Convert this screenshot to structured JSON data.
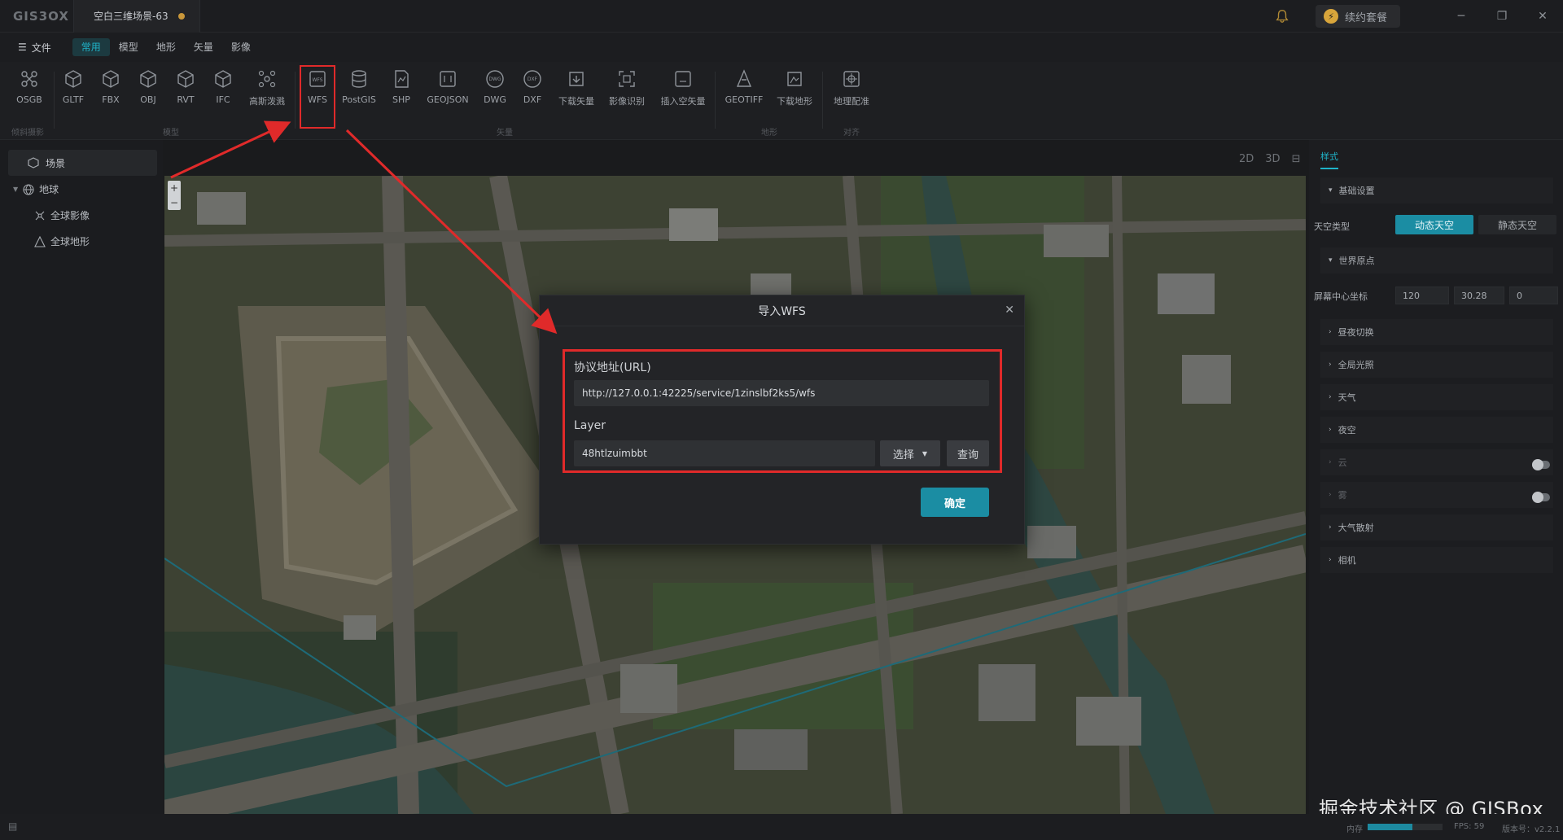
{
  "titlebar": {
    "logo": "GIS3OX",
    "doc_title": "空白三维场景-63",
    "renew_label": "续约套餐"
  },
  "menubar": {
    "file_label": "文件",
    "items": [
      "常用",
      "模型",
      "地形",
      "矢量",
      "影像"
    ]
  },
  "ribbon": {
    "tools": {
      "osgb": "OSGB",
      "gltf": "GLTF",
      "fbx": "FBX",
      "obj": "OBJ",
      "rvt": "RVT",
      "ifc": "IFC",
      "gauss": "高斯泼溅",
      "wfs": "WFS",
      "postgis": "PostGIS",
      "shp": "SHP",
      "geojson": "GEOJSON",
      "dwg": "DWG",
      "dxf": "DXF",
      "download_vector": "下载矢量",
      "image_recog": "影像识别",
      "insert_empty_vector": "插入空矢量",
      "geotiff": "GEOTIFF",
      "download_terrain": "下载地形",
      "georef": "地理配准"
    },
    "groups": {
      "tilt": "倾斜摄影",
      "model": "模型",
      "vector": "矢量",
      "terrain": "地形",
      "align": "对齐"
    }
  },
  "leftpanel": {
    "scene_label": "场景",
    "earth_label": "地球",
    "global_imagery": "全球影像",
    "global_terrain": "全球地形"
  },
  "viewtabs": [
    "2D",
    "3D",
    "⊟"
  ],
  "rightpanel": {
    "tab_label": "样式",
    "basic_settings": "基础设置",
    "sky_type_label": "天空类型",
    "sky_dynamic": "动态天空",
    "sky_static": "静态天空",
    "world_origin": "世界原点",
    "screen_center_label": "屏幕中心坐标",
    "coord_x": "120",
    "coord_y": "30.28",
    "coord_z": "0",
    "day_night": "昼夜切换",
    "global_light": "全局光照",
    "weather": "天气",
    "night_sky": "夜空",
    "cloud": "云",
    "fog": "雾",
    "atmosphere": "大气散射",
    "camera": "相机"
  },
  "dialog": {
    "title": "导入WFS",
    "url_label": "协议地址(URL)",
    "url_value": "http://127.0.0.1:42225/service/1zinslbf2ks5/wfs",
    "layer_label": "Layer",
    "layer_value": "48htlzuimbbt",
    "select_label": "选择",
    "query_label": "查询",
    "ok_label": "确定"
  },
  "statusbar": {
    "mem_label": "内存",
    "mem_fraction": 0.6,
    "fps": "FPS: 59",
    "version": "版本号：v2.2.1"
  },
  "watermark": "掘金技术社区 @ GISBox",
  "colors": {
    "accent": "#1b8da3",
    "highlight_red": "#e02a2a"
  }
}
